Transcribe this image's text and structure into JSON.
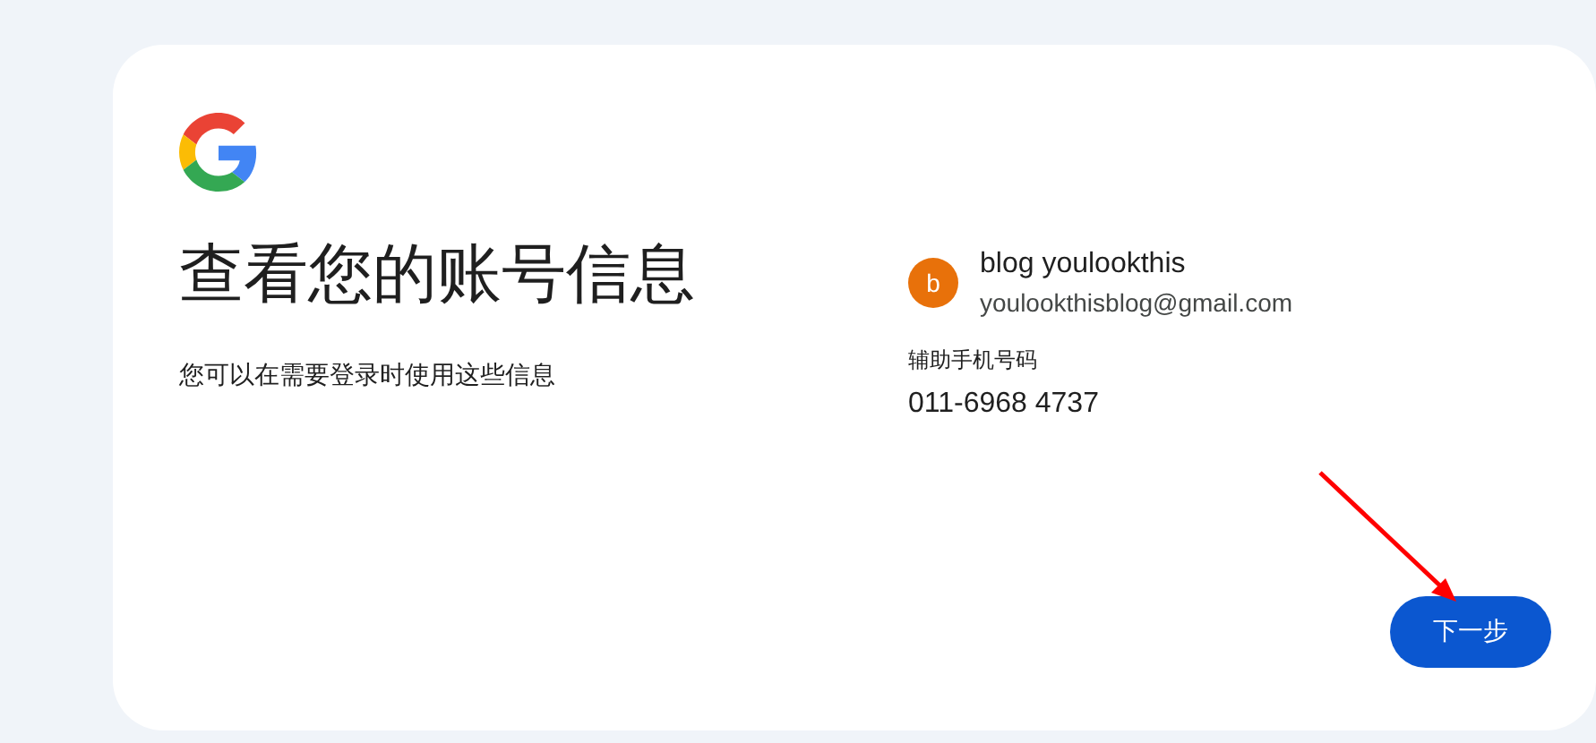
{
  "heading": "查看您的账号信息",
  "subtitle": "您可以在需要登录时使用这些信息",
  "account": {
    "avatar_letter": "b",
    "color": "#e8710a",
    "name": "blog youlookthis",
    "email": "youlookthisblog@gmail.com"
  },
  "recovery_phone": {
    "label": "辅助手机号码",
    "value": "011-6968 4737"
  },
  "buttons": [
    {
      "label": "下一步"
    }
  ]
}
